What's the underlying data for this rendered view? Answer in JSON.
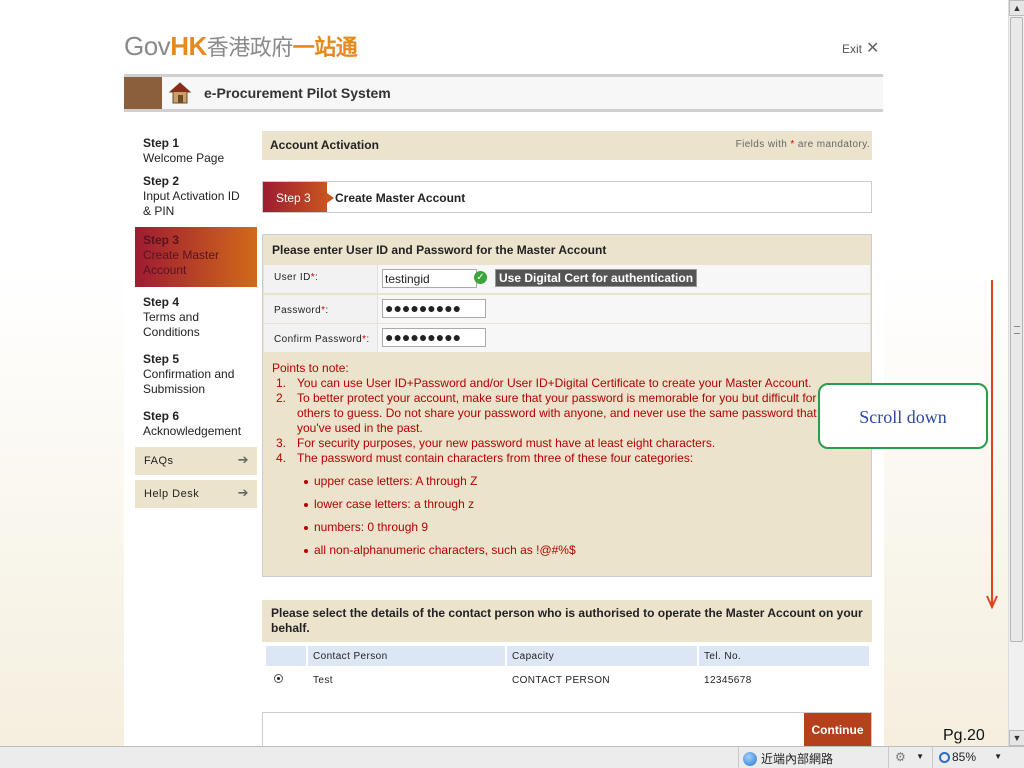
{
  "header": {
    "logo_gov": "Gov",
    "logo_hk": "HK",
    "logo_zh1": "香港政府",
    "logo_zh2": "一站通",
    "exit_label": "Exit",
    "system_title": "e-Procurement Pilot System"
  },
  "steps": [
    {
      "num": "Step 1",
      "label": "Welcome Page"
    },
    {
      "num": "Step 2",
      "label": "Input Activation ID & PIN"
    },
    {
      "num": "Step 3",
      "label": "Create Master Account"
    },
    {
      "num": "Step 4",
      "label": "Terms and Conditions"
    },
    {
      "num": "Step 5",
      "label": "Confirmation and Submission"
    },
    {
      "num": "Step 6",
      "label": "Acknowledgement"
    }
  ],
  "sidebar": {
    "faqs_label": "FAQs",
    "helpdesk_label": "Help Desk"
  },
  "main": {
    "section_title": "Account Activation",
    "mandatory_pre": "Fields with ",
    "mandatory_star": "*",
    "mandatory_post": " are mandatory.",
    "step_tag": "Step 3",
    "step_title": "Create Master Account",
    "form_heading": "Please enter User ID and Password for the Master Account",
    "userid_label": "User ID",
    "userid_value": "testingid",
    "cert_button": "Use Digital Cert for authentication",
    "password_label": "Password",
    "password_value": "●●●●●●●●●",
    "confirm_label": "Confirm Password",
    "confirm_value": "●●●●●●●●●",
    "req_star": "*",
    "colon": ":",
    "notes_title": "Points to note:",
    "notes": [
      {
        "n": "1.",
        "text": "You can use User ID+Password and/or User ID+Digital Certificate to create your Master Account."
      },
      {
        "n": "2.",
        "text": "To better protect your account, make sure that your password is memorable for you but difficult for others to guess. Do not share your password with anyone, and never use the same password that you've used in the past."
      },
      {
        "n": "3.",
        "text": "For security purposes, your new password must have at least eight characters."
      },
      {
        "n": "4.",
        "text": "The password must contain characters from three of these four categories:"
      }
    ],
    "categories": [
      "upper case letters: A through Z",
      "lower case letters: a through z",
      "numbers: 0 through 9",
      "all non-alphanumeric characters, such as !@#%$"
    ],
    "contact_heading": "Please select the details of the contact person who is authorised to operate the Master Account on your behalf.",
    "contact_table": {
      "headers": [
        "",
        "Contact Person",
        "Capacity",
        "Tel. No."
      ],
      "rows": [
        {
          "person": "Test",
          "capacity": "CONTACT PERSON",
          "tel": "12345678",
          "selected": true
        }
      ]
    },
    "continue_label": "Continue"
  },
  "annotation": {
    "callout": "Scroll down",
    "page_label": "Pg.20"
  },
  "statusbar": {
    "zone": "近端內部網路",
    "zoom": "85%"
  },
  "colors": {
    "accent": "#e58a1f",
    "band": "#ebe3cc",
    "note_red": "#b80000",
    "continue": "#b5401c"
  }
}
